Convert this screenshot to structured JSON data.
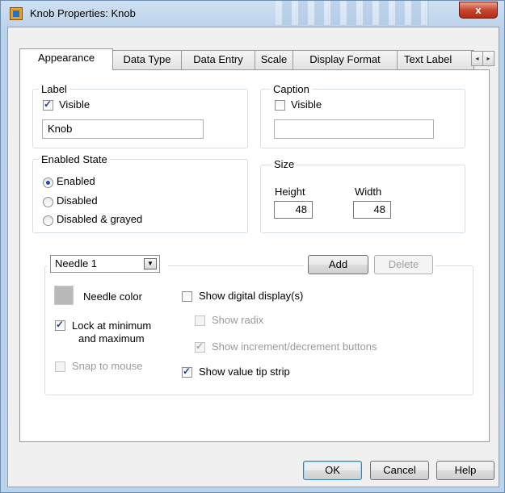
{
  "window": {
    "title": "Knob Properties: Knob",
    "close_glyph": "x"
  },
  "tabs": [
    {
      "label": "Appearance",
      "active": true
    },
    {
      "label": "Data Type",
      "active": false
    },
    {
      "label": "Data Entry",
      "active": false
    },
    {
      "label": "Scale",
      "active": false
    },
    {
      "label": "Display Format",
      "active": false
    },
    {
      "label": "Text Label",
      "active": false
    }
  ],
  "tab_scroll": {
    "left_glyph": "◂",
    "right_glyph": "▸"
  },
  "label_group": {
    "title": "Label",
    "visible_label": "Visible",
    "visible_checked": true,
    "value": "Knob"
  },
  "caption_group": {
    "title": "Caption",
    "visible_label": "Visible",
    "visible_checked": false,
    "value": ""
  },
  "enabled_group": {
    "title": "Enabled State",
    "options": [
      "Enabled",
      "Disabled",
      "Disabled & grayed"
    ],
    "selected": "Enabled"
  },
  "size_group": {
    "title": "Size",
    "height_label": "Height",
    "width_label": "Width",
    "height": "48",
    "width": "48"
  },
  "needle_group": {
    "selected_needle": "Needle 1",
    "add_label": "Add",
    "delete_label": "Delete",
    "needle_color_label": "Needle color",
    "needle_color": "#b9b9b9",
    "lock_label_line1": "Lock at minimum",
    "lock_label_line2": "and maximum",
    "lock_checked": true,
    "snap_label": "Snap to mouse",
    "snap_checked": false,
    "show_digital_label": "Show digital display(s)",
    "show_digital_checked": false,
    "show_radix_label": "Show radix",
    "show_radix_checked": false,
    "show_incdec_label": "Show increment/decrement buttons",
    "show_incdec_checked": true,
    "show_tip_label": "Show value tip strip",
    "show_tip_checked": true
  },
  "footer": {
    "ok_label": "OK",
    "cancel_label": "Cancel",
    "help_label": "Help"
  },
  "colors": {
    "title_gradient": "#b9d1ea",
    "close_button": "#c7462f",
    "dialog_bg": "#f0f0f0"
  }
}
